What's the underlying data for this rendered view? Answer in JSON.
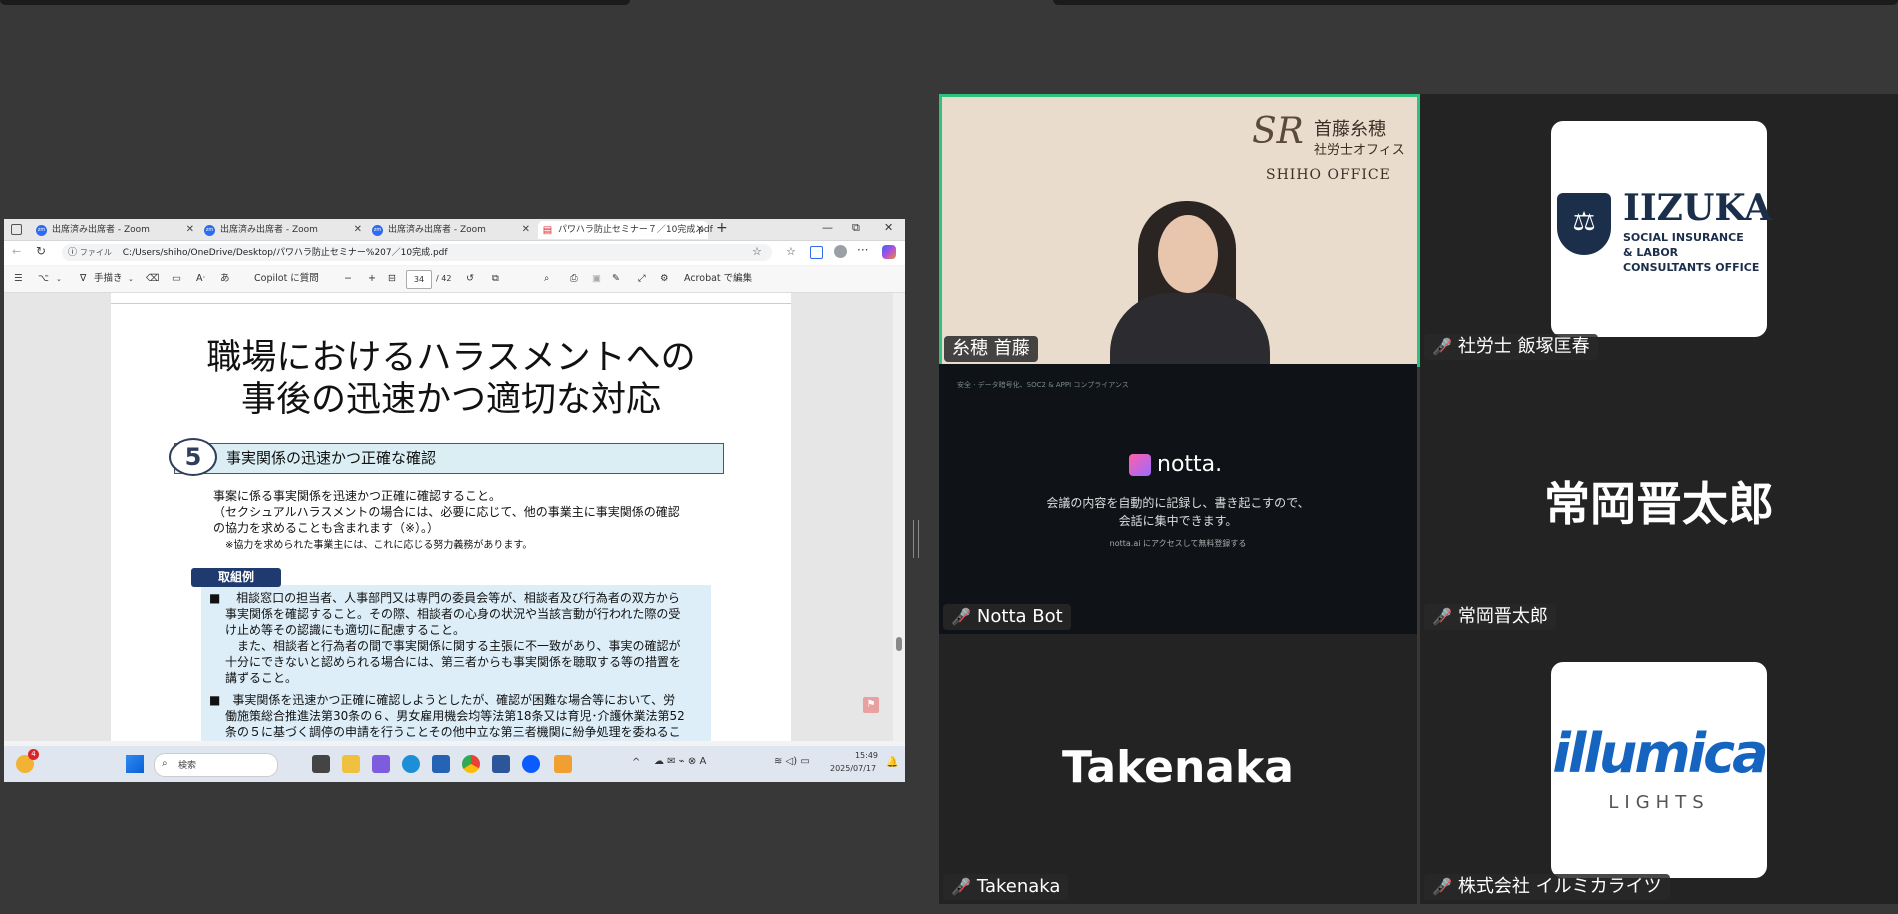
{
  "browser": {
    "tabs": [
      {
        "label": "出席済み出席者 - Zoom",
        "icon": "zoom-icon"
      },
      {
        "label": "出席済み出席者 - Zoom",
        "icon": "zoom-icon"
      },
      {
        "label": "出席済み出席者 - Zoom",
        "icon": "zoom-icon"
      },
      {
        "label": "パワハラ防止セミナー７／10完成.pdf",
        "icon": "pdf-icon"
      }
    ],
    "new_tab": "+",
    "url_prefix": "ファイル",
    "url": "C:/Users/shiho/OneDrive/Desktop/パワハラ防止セミナー%207／10完成.pdf"
  },
  "pdf_toolbar": {
    "draw": "手描き",
    "copilot": "Copilot に質問",
    "page_current": "34",
    "page_total": "/ 42",
    "acrobat": "Acrobat で編集"
  },
  "slide": {
    "title_line1": "職場におけるハラスメントへの",
    "title_line2": "事後の迅速かつ適切な対応",
    "section_number": "5",
    "section_title": "事実関係の迅速かつ正確な確認",
    "body_line1": "事案に係る事実関係を迅速かつ正確に確認すること。",
    "body_line2": "（セクシュアルハラスメントの場合には、必要に応じて、他の事業主に事実関係の確認",
    "body_line3": "の協力を求めることも含まれます（※）。）",
    "body_note": "※協力を求められた事業主には、これに応じる努力義務があります。",
    "example_label": "取組例",
    "ex1_l1": "■　 相談窓口の担当者、人事部門又は専門の委員会等が、相談者及び行為者の双方から",
    "ex1_l2": "事実関係を確認すること。その際、相談者の心身の状況や当該言動が行われた際の受",
    "ex1_l3": "け止め等その認識にも適切に配慮すること。",
    "ex1_l4": "　また、相談者と行為者の間で事実関係に関する主張に不一致があり、事実の確認が",
    "ex1_l5": "十分にできないと認められる場合には、第三者からも事実関係を聴取する等の措置を",
    "ex1_l6": "講ずること。",
    "ex2_l1": "■　事実関係を迅速かつ正確に確認しようとしたが、確認が困難な場合等において、労",
    "ex2_l2": "働施策総合推進法第30条の６、男女雇用機会均等法第18条又は育児･介護休業法第52",
    "ex2_l3": "条の５に基づく調停の申請を行うことその他中立な第三者機関に紛争処理を委ねるこ"
  },
  "taskbar": {
    "badge": "4",
    "search": "検索",
    "time": "15:49",
    "date": "2025/07/17"
  },
  "participants": [
    {
      "name": "糸穂 首藤",
      "muted": false,
      "active_speaker": true,
      "background_logo": {
        "brand": "首藤糸穂",
        "sub": "社労士オフィス",
        "en": "SHIHO OFFICE",
        "mark": "SR"
      }
    },
    {
      "name": "社労士 飯塚匡春",
      "muted": true,
      "logo": {
        "title": "IIZUKA",
        "line1": "SOCIAL INSURANCE",
        "line2": "& LABOR",
        "line3": "CONSULTANTS OFFICE"
      }
    },
    {
      "name": "Notta Bot",
      "muted": true,
      "screen": {
        "badge": "安全 · データ暗号化、SOC2 & APPI コンプライアンス",
        "brand": "notta.",
        "msg1": "会議の内容を自動的に記録し、書き起こすので、",
        "msg2": "会話に集中できます。",
        "link": "notta.ai にアクセスして無料登録する"
      }
    },
    {
      "name": "常岡晋太郎",
      "muted": true,
      "display": "常岡晋太郎"
    },
    {
      "name": "Takenaka",
      "muted": true,
      "display": "Takenaka"
    },
    {
      "name": "株式会社 イルミカライツ",
      "muted": true,
      "logo": {
        "title": "illumica",
        "sub": "LIGHTS"
      }
    }
  ],
  "colors": {
    "active_speaker_border": "#2ec27e",
    "mute_icon": "#ff4e4e",
    "section_num": "#2f3e5c",
    "example_label_bg": "#1f3a6e",
    "illumica_blue": "#1565c0"
  }
}
